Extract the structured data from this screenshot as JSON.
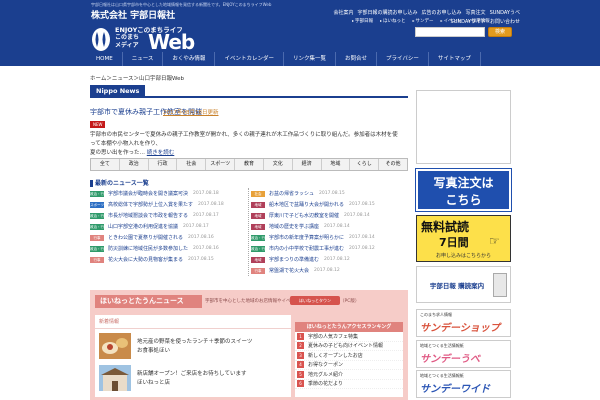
{
  "header": {
    "tagline": "宇部日報社は山口県宇部市を中心とした地域情報を発信する新聞社です。ENJOYこのまちライフWeb",
    "company": "株式会社 宇部日報社",
    "logo_line1": "ENJOYこのまちライフ",
    "logo_line2": "このまち メディア",
    "logo_web": "Web",
    "top_links": [
      "会社案内",
      "宇部日報の購読お申し込み",
      "広告のお申し込み",
      "写真注文",
      "SUNDAYうべ",
      "SUNDAYワイド",
      "お問い合わせ"
    ],
    "sub_sites": [
      "宇部日報",
      "ほいねっと",
      "サンデー",
      "イベント",
      "採用情報"
    ],
    "search_placeholder": "",
    "search_button": "検索"
  },
  "gnav": [
    "HOME",
    "ニュース",
    "おくやみ情報",
    "イベントカレンダー",
    "リンク集一覧",
    "お問合せ",
    "プライバシー",
    "サイトマップ"
  ],
  "breadcrumb": "ホーム＞ニュース＞山口宇部日報Web",
  "section_label": "Nippo News",
  "article": {
    "title": "宇部市で夏休み親子工作教室を開催",
    "date": "2017年08月18日更新",
    "badge": "NEW",
    "body": "宇部市の市民センターで夏休みの親子工作教室が開かれ、多くの親子連れが木工作品づくりに取り組んだ。参加者は木材を使って本棚や小物入れを作り、",
    "more_prefix": "夏の思い出を作った",
    "more_label": "続きを読む"
  },
  "tabs": [
    "全て",
    "政治",
    "行政",
    "社会",
    "スポーツ",
    "教育",
    "文化",
    "経済",
    "地域",
    "くらし",
    "その他"
  ],
  "list_heading": "最新のニュース一覧",
  "news_left": [
    {
      "cat": "政治・行政",
      "color": "#2f9a6a",
      "title": "宇部市議会が臨時会を開き議案可決",
      "date": "2017.08.18"
    },
    {
      "cat": "スポーツ",
      "color": "#2d6fc4",
      "title": "高校総体で宇部勢が上位入賞を果たす",
      "date": "2017.08.18"
    },
    {
      "cat": "政治・行政",
      "color": "#2f9a6a",
      "title": "市長が地域懇談会で市政を報告する",
      "date": "2017.08.17"
    },
    {
      "cat": "政治・行政",
      "color": "#2f9a6a",
      "title": "山口宇部空港の利用促進を協議",
      "date": "2017.08.17"
    },
    {
      "cat": "行事",
      "color": "#e0837e",
      "title": "ときわ公園で夏祭りが開催される",
      "date": "2017.08.16"
    },
    {
      "cat": "政治・行政",
      "color": "#2f9a6a",
      "title": "防災訓練に地域住民が多数参加した",
      "date": "2017.08.16"
    },
    {
      "cat": "行事",
      "color": "#e0837e",
      "title": "花火大会に大勢の見物客が集まる",
      "date": "2017.08.15"
    }
  ],
  "news_right": [
    {
      "cat": "社会",
      "color": "#e8a13a",
      "title": "お盆の帰省ラッシュ",
      "date": "2017.08.15"
    },
    {
      "cat": "地域",
      "color": "#b0405a",
      "title": "船木地区で盆踊り大会が開かれる",
      "date": "2017.08.15"
    },
    {
      "cat": "地域",
      "color": "#b0405a",
      "title": "厚東川で子ども水辺教室を開催",
      "date": "2017.08.14"
    },
    {
      "cat": "地域",
      "color": "#b0405a",
      "title": "地域の歴史を学ぶ講座",
      "date": "2017.08.14"
    },
    {
      "cat": "政治・行政",
      "color": "#2f9a6a",
      "title": "宇部市の新年度予算案が明らかに",
      "date": "2017.08.14"
    },
    {
      "cat": "政治・行政",
      "color": "#2f9a6a",
      "title": "市内の小中学校で耐震工事が進む",
      "date": "2017.08.12"
    },
    {
      "cat": "地域",
      "color": "#b0405a",
      "title": "宇部まつりの準備進む",
      "date": "2017.08.12"
    },
    {
      "cat": "行事",
      "color": "#e0837e",
      "title": "常盤湖で花火大会",
      "date": "2017.08.12"
    }
  ],
  "hoi": {
    "title": "ほいねっとたうんニュース",
    "subtitle": "宇部市を中心とした地域のお店情報やイベント情報をお届けします（PC版）",
    "brand": "ほいねっとタウン",
    "left_head": "新着情報",
    "items": [
      {
        "line1": "地元産の野菜を使ったランチ＋季節のスイーツ",
        "line2": "お食事処ほい"
      },
      {
        "line1": "新店舗オープン！ご来店をお待ちしています",
        "line2": "ほいねっと店"
      }
    ],
    "rank_head": "ほいねっとたうんアクセスランキング",
    "ranks": [
      "宇部の人気カフェ特集",
      "夏休みの子ども向けイベント情報",
      "新しくオープンしたお店",
      "お得なクーポン",
      "地元グルメ紹介",
      "季節の花だより"
    ]
  },
  "sidebar": {
    "photo_line1": "写真注文は",
    "photo_line2": "こちら",
    "trial_line1": "無料試読",
    "trial_line2": "7日間",
    "trial_line3": "お申し込みはこちらから",
    "subscribe": "宇部日報 購読案内",
    "banners": [
      {
        "small": "このまち求人情報",
        "big": "サンデーショップ",
        "color": "#d9533d"
      },
      {
        "small": "地域とつくる生活情報紙",
        "big": "サンデーうべ",
        "color": "#e05a84"
      },
      {
        "small": "地域とつくる生活情報紙",
        "big": "サンデーワイド",
        "color": "#2c56b5"
      }
    ]
  }
}
